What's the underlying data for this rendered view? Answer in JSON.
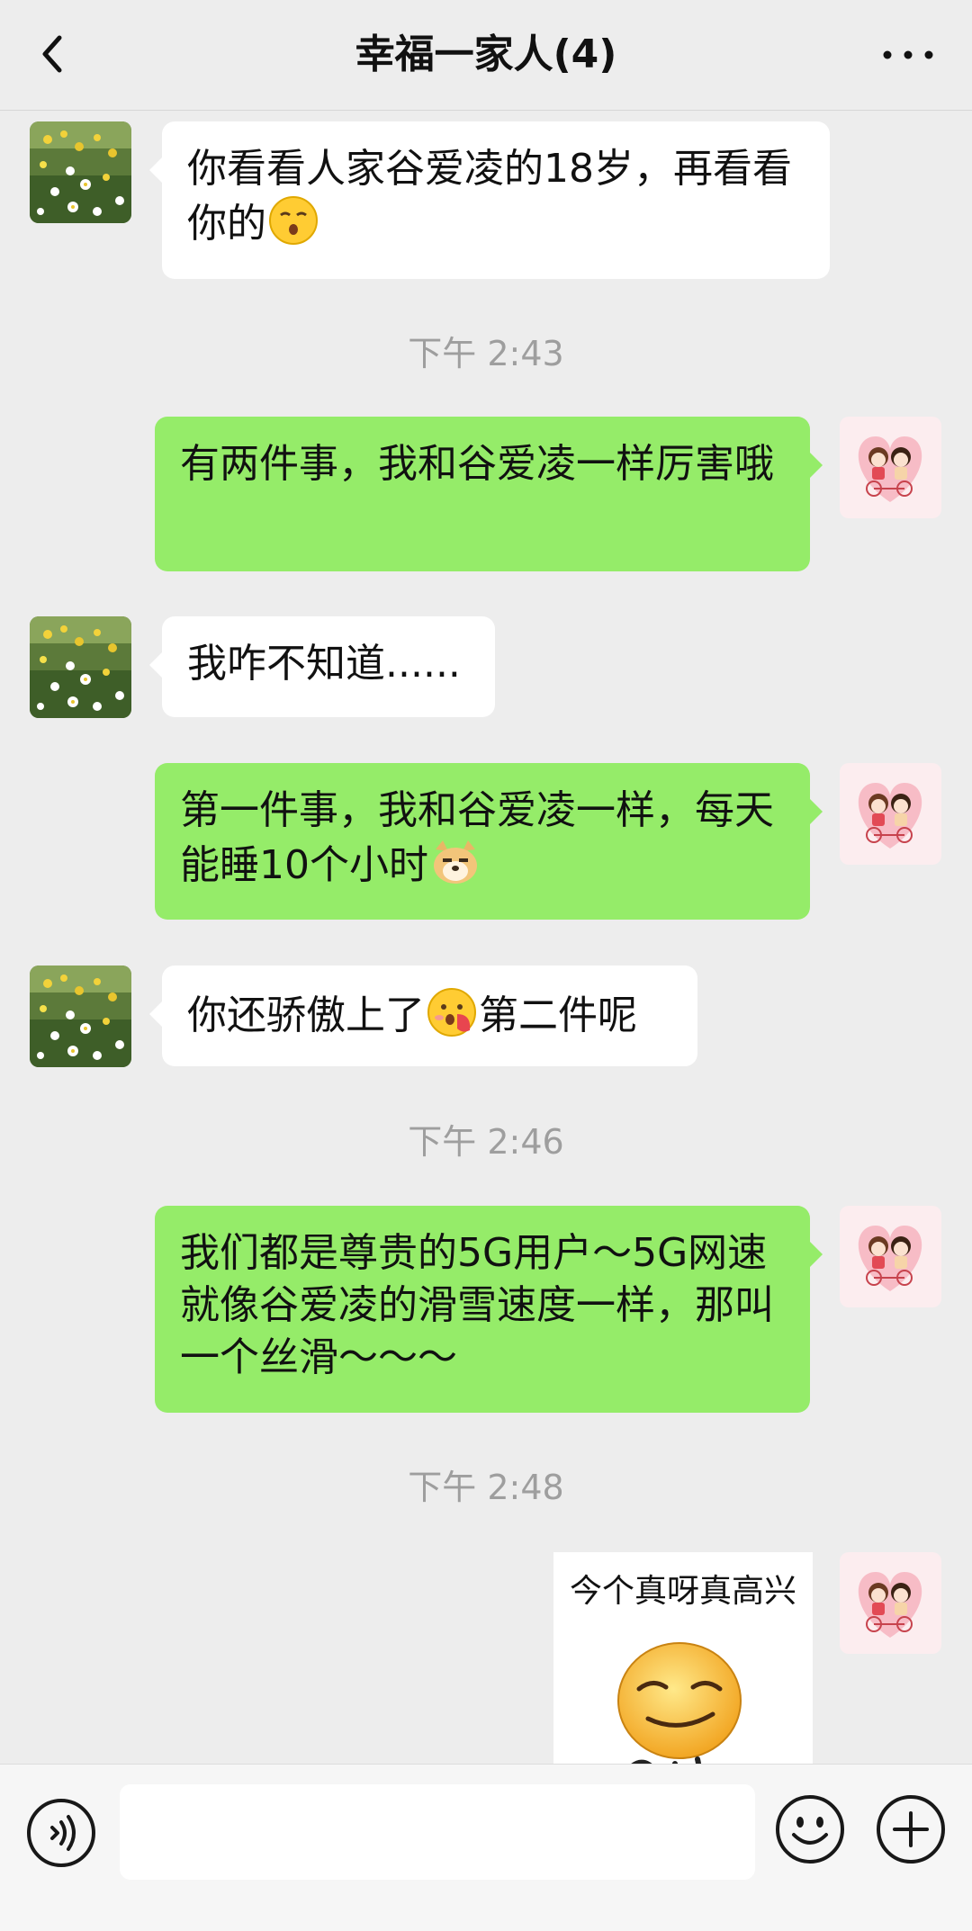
{
  "header": {
    "title": "幸福一家人(4)",
    "back_icon": "chevron-left-icon",
    "more_icon": "ellipsis-icon"
  },
  "messages": [
    {
      "side": "left",
      "text": "你看看人家谷爱凌的18岁，再看看你的",
      "emoji": "shush-face"
    },
    {
      "type": "time",
      "text": "下午 2:43"
    },
    {
      "side": "right",
      "text": "有两件事，我和谷爱凌一样厉害哦"
    },
    {
      "side": "left",
      "text": "我咋不知道......"
    },
    {
      "side": "right",
      "text": "第一件事，我和谷爱凌一样，每天能睡10个小时",
      "emoji": "doge-face"
    },
    {
      "side": "left",
      "text_a": "你还骄傲上了",
      "text_b": "第二件呢",
      "emoji": "hand-over-mouth-face"
    },
    {
      "type": "time",
      "text": "下午 2:46"
    },
    {
      "side": "right",
      "text": "我们都是尊贵的5G用户～5G网速就像谷爱凌的滑雪速度一样，那叫一个丝滑～～～"
    },
    {
      "type": "time",
      "text": "下午 2:48"
    },
    {
      "side": "right",
      "type": "sticker",
      "caption": "今个真呀真高兴"
    }
  ],
  "input_bar": {
    "voice_icon": "voice-icon",
    "placeholder": "",
    "emoji_icon": "smiley-icon",
    "plus_icon": "plus-circle-icon"
  },
  "colors": {
    "background": "#EDEDED",
    "bubble_self": "#95EC69",
    "bubble_other": "#FFFFFF",
    "timestamp": "#9E9E9E"
  }
}
